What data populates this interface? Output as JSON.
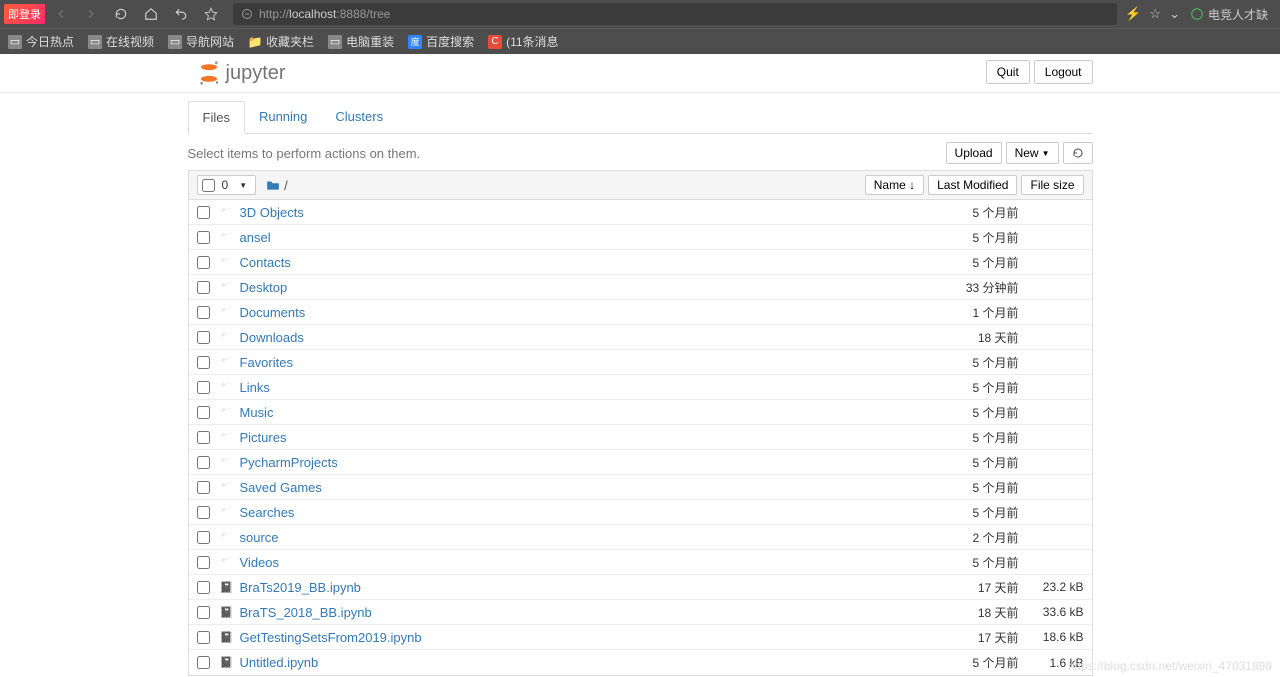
{
  "chrome": {
    "login_badge": "即登录",
    "url_prefix": "http://",
    "url_domain": "localhost",
    "url_rest": ":8888/tree",
    "game_widget": "电竞人才缺"
  },
  "bookmarks": [
    {
      "label": "今日热点",
      "icon": "doc"
    },
    {
      "label": "在线视频",
      "icon": "doc"
    },
    {
      "label": "导航网站",
      "icon": "doc"
    },
    {
      "label": "收藏夹栏",
      "icon": "folder"
    },
    {
      "label": "电脑重装",
      "icon": "doc"
    },
    {
      "label": "百度搜索",
      "icon": "baidu"
    },
    {
      "label": "(11条消息",
      "icon": "red"
    }
  ],
  "header": {
    "logo_text": "jupyter",
    "quit": "Quit",
    "logout": "Logout"
  },
  "tabs": {
    "files": "Files",
    "running": "Running",
    "clusters": "Clusters"
  },
  "toolbar": {
    "hint": "Select items to perform actions on them.",
    "upload": "Upload",
    "new": "New"
  },
  "list_header": {
    "count": "0",
    "breadcrumb_sep": "/",
    "name": "Name",
    "last_modified": "Last Modified",
    "file_size": "File size"
  },
  "files": [
    {
      "name": "3D Objects",
      "type": "folder",
      "modified": "5 个月前",
      "size": ""
    },
    {
      "name": "ansel",
      "type": "folder",
      "modified": "5 个月前",
      "size": ""
    },
    {
      "name": "Contacts",
      "type": "folder",
      "modified": "5 个月前",
      "size": ""
    },
    {
      "name": "Desktop",
      "type": "folder",
      "modified": "33 分钟前",
      "size": ""
    },
    {
      "name": "Documents",
      "type": "folder",
      "modified": "1 个月前",
      "size": ""
    },
    {
      "name": "Downloads",
      "type": "folder",
      "modified": "18 天前",
      "size": ""
    },
    {
      "name": "Favorites",
      "type": "folder",
      "modified": "5 个月前",
      "size": ""
    },
    {
      "name": "Links",
      "type": "folder",
      "modified": "5 个月前",
      "size": ""
    },
    {
      "name": "Music",
      "type": "folder",
      "modified": "5 个月前",
      "size": ""
    },
    {
      "name": "Pictures",
      "type": "folder",
      "modified": "5 个月前",
      "size": ""
    },
    {
      "name": "PycharmProjects",
      "type": "folder",
      "modified": "5 个月前",
      "size": ""
    },
    {
      "name": "Saved Games",
      "type": "folder",
      "modified": "5 个月前",
      "size": ""
    },
    {
      "name": "Searches",
      "type": "folder",
      "modified": "5 个月前",
      "size": ""
    },
    {
      "name": "source",
      "type": "folder",
      "modified": "2 个月前",
      "size": ""
    },
    {
      "name": "Videos",
      "type": "folder",
      "modified": "5 个月前",
      "size": ""
    },
    {
      "name": "BraTs2019_BB.ipynb",
      "type": "notebook",
      "modified": "17 天前",
      "size": "23.2 kB"
    },
    {
      "name": "BraTS_2018_BB.ipynb",
      "type": "notebook",
      "modified": "18 天前",
      "size": "33.6 kB"
    },
    {
      "name": "GetTestingSetsFrom2019.ipynb",
      "type": "notebook",
      "modified": "17 天前",
      "size": "18.6 kB"
    },
    {
      "name": "Untitled.ipynb",
      "type": "notebook",
      "modified": "5 个月前",
      "size": "1.6 kB"
    }
  ],
  "watermark": "https://blog.csdn.net/weixin_47031898"
}
